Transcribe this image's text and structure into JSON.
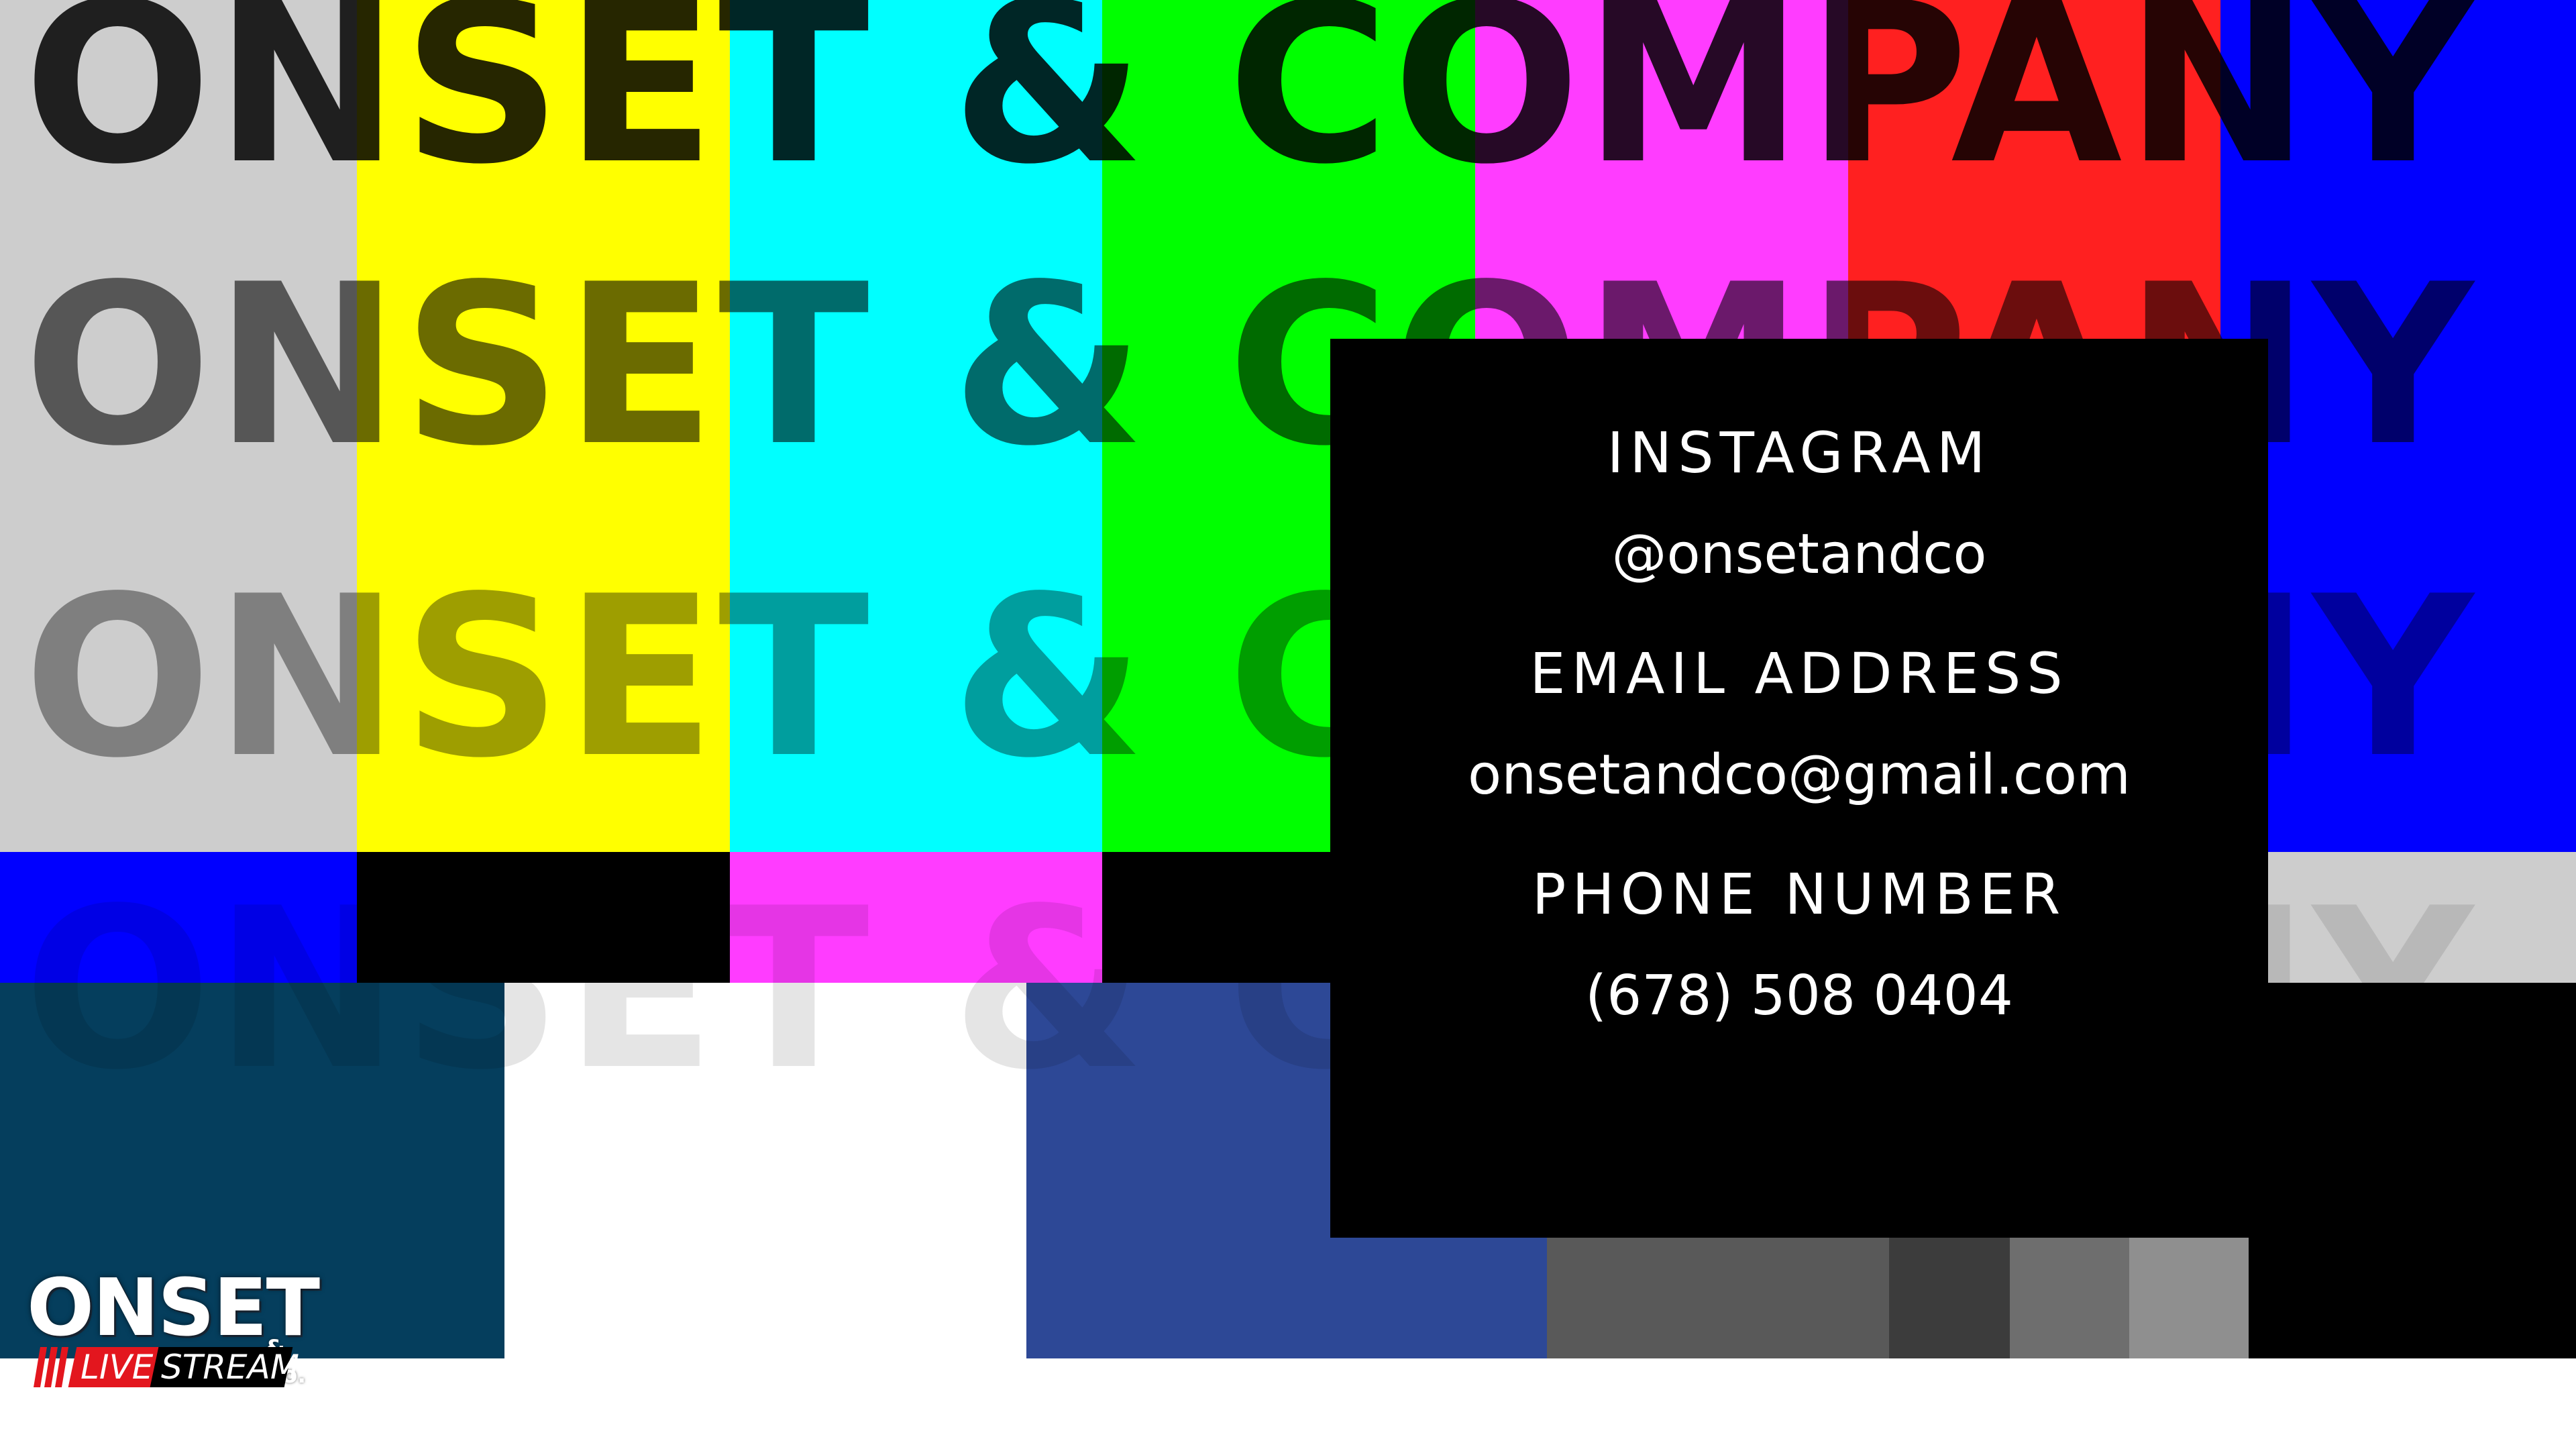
{
  "background": {
    "top_bars": [
      "#cdcdcd",
      "#ffff00",
      "#00ffff",
      "#00ff00",
      "#ff3cff",
      "#ff2020",
      "#0000ff"
    ],
    "middle_bars": [
      "#0000ff",
      "#000000",
      "#ff3cff",
      "#000000",
      "#00ffff",
      "#000000",
      "#cdcdcd"
    ],
    "bottom_bars": [
      "#053e5d",
      "#ffffff",
      "#2d4896",
      "#595959",
      "#3c3c3c",
      "#6e6e6e",
      "#8f8f8f",
      "#000000"
    ]
  },
  "wordmark": {
    "text": "ONSET & COMPANY",
    "rows": [
      {
        "text": "ONSET & COMPANY",
        "color": "rgba(0,0,0,0.85)"
      },
      {
        "text": "ONSET & COMPANY",
        "color": "rgba(0,0,0,0.58)"
      },
      {
        "text": "ONSET & COMPANY",
        "color": "rgba(0,0,0,0.38)"
      },
      {
        "text": "ONSET & COMPANY",
        "color": "rgba(0,0,0,0.10)"
      }
    ]
  },
  "contact": {
    "instagram_label": "INSTAGRAM",
    "instagram_handle": "@onsetandco",
    "email_label": "EMAIL ADDRESS",
    "email_value": "onsetandco@gmail.com",
    "phone_label": "PHONE NUMBER",
    "phone_value": "(678) 508 0404"
  },
  "logo": {
    "name": "ONSET",
    "suffix": "& Co.",
    "live": "LIVE",
    "stream": "STREAM",
    "accent": "#e3161e"
  }
}
